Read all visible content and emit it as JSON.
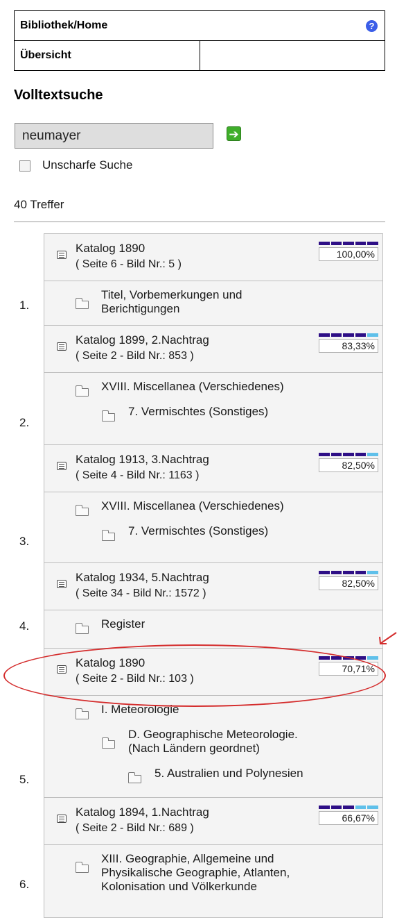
{
  "nav": {
    "home": "Bibliothek/Home",
    "overview": "Übersicht",
    "help_icon": "?"
  },
  "search": {
    "section_title": "Volltextsuche",
    "query": "neumayer",
    "go_icon": "arrow-right-icon",
    "fuzzy_label": "Unscharfe Suche",
    "fuzzy_checked": false,
    "hits": "40 Treffer"
  },
  "results": [
    {
      "number": "1.",
      "title": "Katalog 1890",
      "subtitle": "( Seite 6 - Bild Nr.: 5 )",
      "score_label": "100,00%",
      "score_segments": 5,
      "tree": [
        {
          "level": 1,
          "lines": [
            "Titel, Vorbemerkungen und",
            "Berichtigungen"
          ]
        }
      ]
    },
    {
      "number": "2.",
      "title": "Katalog 1899, 2.Nachtrag",
      "subtitle": "( Seite 2 - Bild Nr.: 853 )",
      "score_label": "83,33%",
      "score_segments": 4,
      "tree": [
        {
          "level": 1,
          "lines": [
            "XVIII. Miscellanea (Verschiedenes)"
          ]
        },
        {
          "level": 2,
          "lines": [
            "7. Vermischtes (Sonstiges)"
          ]
        }
      ]
    },
    {
      "number": "3.",
      "title": "Katalog 1913, 3.Nachtrag",
      "subtitle": "( Seite 4 - Bild Nr.: 1163 )",
      "score_label": "82,50%",
      "score_segments": 4,
      "tree": [
        {
          "level": 1,
          "lines": [
            "XVIII. Miscellanea (Verschiedenes)"
          ]
        },
        {
          "level": 2,
          "lines": [
            "7. Vermischtes (Sonstiges)"
          ]
        }
      ]
    },
    {
      "number": "4.",
      "title": "Katalog 1934, 5.Nachtrag",
      "subtitle": "( Seite 34 - Bild Nr.: 1572 )",
      "score_label": "82,50%",
      "score_segments": 4,
      "tree": [
        {
          "level": 1,
          "lines": [
            "Register"
          ]
        }
      ]
    },
    {
      "number": "5.",
      "title": "Katalog 1890",
      "subtitle": "( Seite 2 - Bild Nr.: 103 )",
      "score_label": "70,71%",
      "score_segments": 4,
      "tree": [
        {
          "level": 1,
          "lines": [
            "I. Meteorologie"
          ]
        },
        {
          "level": 2,
          "lines": [
            "D. Geographische Meteorologie.",
            "(Nach Ländern geordnet)"
          ]
        },
        {
          "level": 3,
          "lines": [
            "5. Australien und Polynesien"
          ]
        }
      ]
    },
    {
      "number": "6.",
      "title": "Katalog 1894, 1.Nachtrag",
      "subtitle": "( Seite 2 - Bild Nr.: 689 )",
      "score_label": "66,67%",
      "score_segments": 3,
      "tree": [
        {
          "level": 1,
          "lines": [
            "XIII. Geographie, Allgemeine und",
            "Physikalische Geographie, Atlanten,",
            "Kolonisation und Völkerkunde"
          ]
        }
      ]
    }
  ],
  "colors": {
    "score_on": "#2e0f86",
    "score_off": "#5fc0ea",
    "highlight": "#d42c2c"
  }
}
